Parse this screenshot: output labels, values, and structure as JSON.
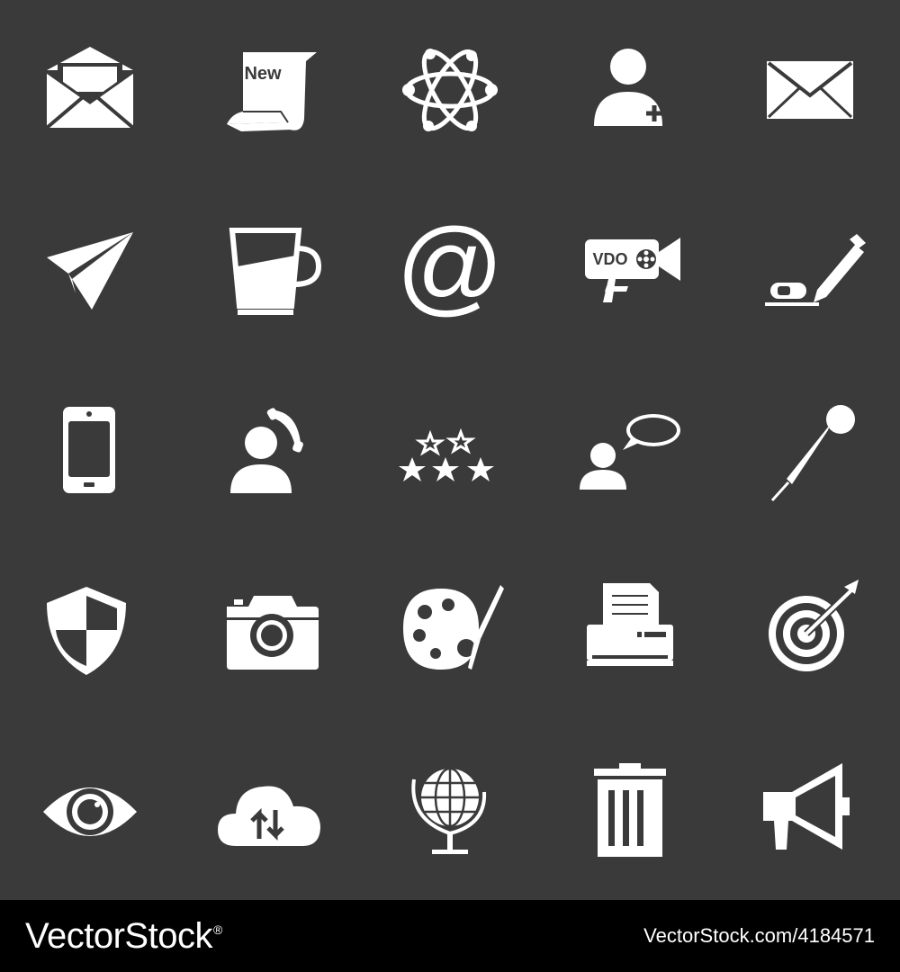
{
  "icons": [
    {
      "name": "open-envelope-icon"
    },
    {
      "name": "new-scroll-icon",
      "label": "New"
    },
    {
      "name": "atom-icon"
    },
    {
      "name": "add-user-icon"
    },
    {
      "name": "envelope-icon"
    },
    {
      "name": "paper-plane-icon"
    },
    {
      "name": "coffee-cup-icon"
    },
    {
      "name": "at-sign-icon",
      "label": "@"
    },
    {
      "name": "video-camera-icon",
      "label": "VDO"
    },
    {
      "name": "eraser-pencil-icon"
    },
    {
      "name": "smartphone-icon"
    },
    {
      "name": "user-phone-icon"
    },
    {
      "name": "stars-rating-icon"
    },
    {
      "name": "user-speech-bubble-icon"
    },
    {
      "name": "microphone-icon"
    },
    {
      "name": "shield-icon"
    },
    {
      "name": "camera-icon"
    },
    {
      "name": "paint-palette-icon"
    },
    {
      "name": "printer-icon"
    },
    {
      "name": "target-dart-icon"
    },
    {
      "name": "eye-icon"
    },
    {
      "name": "cloud-transfer-icon"
    },
    {
      "name": "globe-icon"
    },
    {
      "name": "trash-can-icon"
    },
    {
      "name": "megaphone-icon"
    }
  ],
  "footer": {
    "brand": "VectorStock",
    "registered": "®",
    "url": "VectorStock.com/4184571"
  },
  "colors": {
    "background": "#3a3a3a",
    "icon": "#ffffff",
    "footer": "#000000"
  }
}
